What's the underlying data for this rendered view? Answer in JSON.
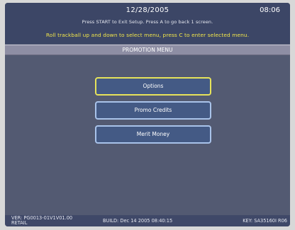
{
  "header": {
    "date": "12/28/2005",
    "time": "08:06",
    "help_text": "Press START to Exit Setup. Press A to go back 1 screen.",
    "instruction": "Roll trackball up and down to select menu, press C to enter selected menu."
  },
  "title": "PROMOTION MENU",
  "menu": {
    "items": [
      {
        "label": "Options",
        "selected": true
      },
      {
        "label": "Promo Credits",
        "selected": false
      },
      {
        "label": "Merit Money",
        "selected": false
      }
    ]
  },
  "footer": {
    "version_line1": "VER: PG0013-01V1V01.00",
    "version_line2": "RETAIL",
    "build": "BUILD: Dec 14 2005 08:40:15",
    "key": "KEY: SA35160I R06"
  },
  "colors": {
    "background": "#535a72",
    "header": "#3c4666",
    "selected_border": "#e7e35a",
    "button_border": "#a9c3ea",
    "instruction_text": "#f2e64a"
  }
}
